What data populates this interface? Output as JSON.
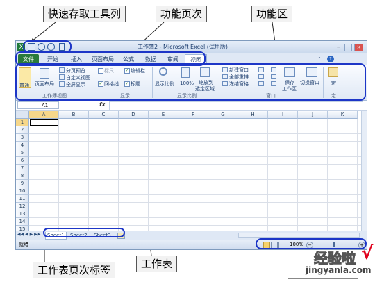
{
  "callouts": {
    "qat": "快速存取工具列",
    "tabs": "功能页次",
    "ribbon": "功能区",
    "sheet_tabs": "工作表页次标签",
    "worksheet": "工作表"
  },
  "window": {
    "title": "工作簿2 - Microsoft Excel (试用版)",
    "tabs": [
      "文件",
      "开始",
      "插入",
      "页面布局",
      "公式",
      "数据",
      "审阅",
      "视图"
    ],
    "active_tab": "视图"
  },
  "ribbon": {
    "workbook_views": {
      "normal": "普通",
      "page_layout": "页面布局",
      "page_break": "分页预览",
      "custom_views": "自定义视图",
      "full_screen": "全屏显示",
      "group_label": "工作簿视图"
    },
    "show": {
      "ruler": "标尺",
      "formula_bar": "编辑栏",
      "gridlines": "网格线",
      "headings": "标题",
      "group_label": "显示"
    },
    "zoom": {
      "zoom": "显示比例",
      "hundred": "100%",
      "zoom_to_selection": "缩放到",
      "zoom_to_selection_2": "选定区域",
      "group_label": "显示比例"
    },
    "window": {
      "new_window": "新建窗口",
      "arrange_all": "全部重排",
      "freeze_panes": "冻结窗格",
      "save_workspace": "保存",
      "save_workspace_2": "工作区",
      "switch_windows": "切换窗口",
      "group_label": "窗口"
    },
    "macros": {
      "macros": "宏",
      "group_label": "宏"
    }
  },
  "formula_bar": {
    "name_box": "A1",
    "fx": "fx"
  },
  "grid": {
    "columns": [
      "A",
      "B",
      "C",
      "D",
      "E",
      "F",
      "G",
      "H",
      "I",
      "J",
      "K"
    ],
    "rows": [
      "1",
      "2",
      "3",
      "4",
      "5",
      "6",
      "7",
      "8",
      "9",
      "10",
      "11",
      "12",
      "13",
      "14",
      "15"
    ]
  },
  "sheets": [
    "Sheet1",
    "Sheet2",
    "Sheet3"
  ],
  "status": {
    "ready": "就绪",
    "zoom": "100%"
  },
  "watermark": {
    "text": "经验啦",
    "check": "√",
    "url": "jingyanla.com"
  },
  "colors": {
    "file_tab": "#2a7a3b",
    "highlight": "#1d36c7",
    "active_cell": "#000000",
    "watermark_check": "#e0001b"
  }
}
